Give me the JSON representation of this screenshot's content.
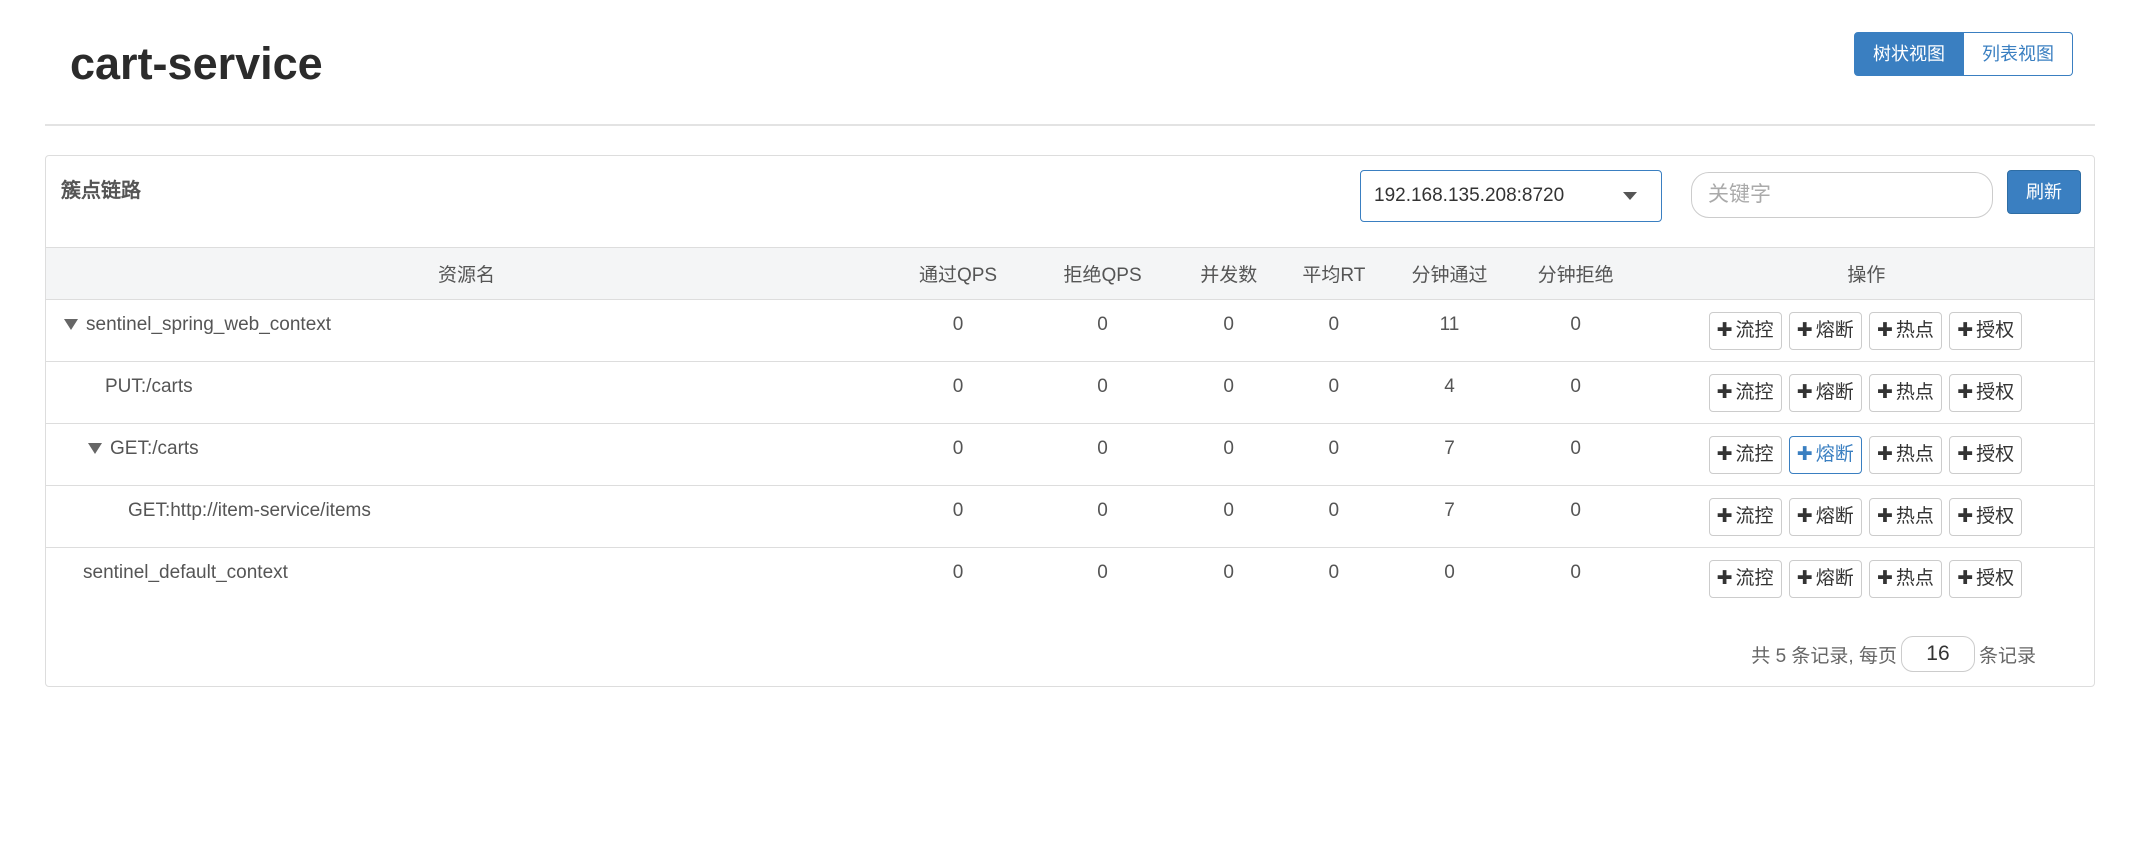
{
  "header": {
    "title": "cart-service",
    "view_tree_label": "树状视图",
    "view_list_label": "列表视图"
  },
  "panel": {
    "title": "簇点链路",
    "machine_select_value": "192.168.135.208:8720",
    "keyword_placeholder": "关键字",
    "refresh_label": "刷新"
  },
  "table": {
    "columns": {
      "resource": "资源名",
      "pass_qps": "通过QPS",
      "block_qps": "拒绝QPS",
      "threads": "并发数",
      "avg_rt": "平均RT",
      "minute_pass": "分钟通过",
      "minute_block": "分钟拒绝",
      "actions": "操作"
    },
    "rows": [
      {
        "name": "sentinel_spring_web_context",
        "pass_qps": "0",
        "block_qps": "0",
        "threads": "0",
        "avg_rt": "0",
        "minute_pass": "11",
        "minute_block": "0"
      },
      {
        "name": "PUT:/carts",
        "pass_qps": "0",
        "block_qps": "0",
        "threads": "0",
        "avg_rt": "0",
        "minute_pass": "4",
        "minute_block": "0"
      },
      {
        "name": "GET:/carts",
        "pass_qps": "0",
        "block_qps": "0",
        "threads": "0",
        "avg_rt": "0",
        "minute_pass": "7",
        "minute_block": "0"
      },
      {
        "name": "GET:http://item-service/items",
        "pass_qps": "0",
        "block_qps": "0",
        "threads": "0",
        "avg_rt": "0",
        "minute_pass": "7",
        "minute_block": "0"
      },
      {
        "name": "sentinel_default_context",
        "pass_qps": "0",
        "block_qps": "0",
        "threads": "0",
        "avg_rt": "0",
        "minute_pass": "0",
        "minute_block": "0"
      }
    ],
    "actions": {
      "plus_glyph": "✚",
      "flow": "流控",
      "degrade": "熔断",
      "hotspot": "热点",
      "authority": "授权"
    }
  },
  "pagination": {
    "prefix": "共 5 条记录, 每页",
    "page_size": "16",
    "suffix": "条记录"
  }
}
